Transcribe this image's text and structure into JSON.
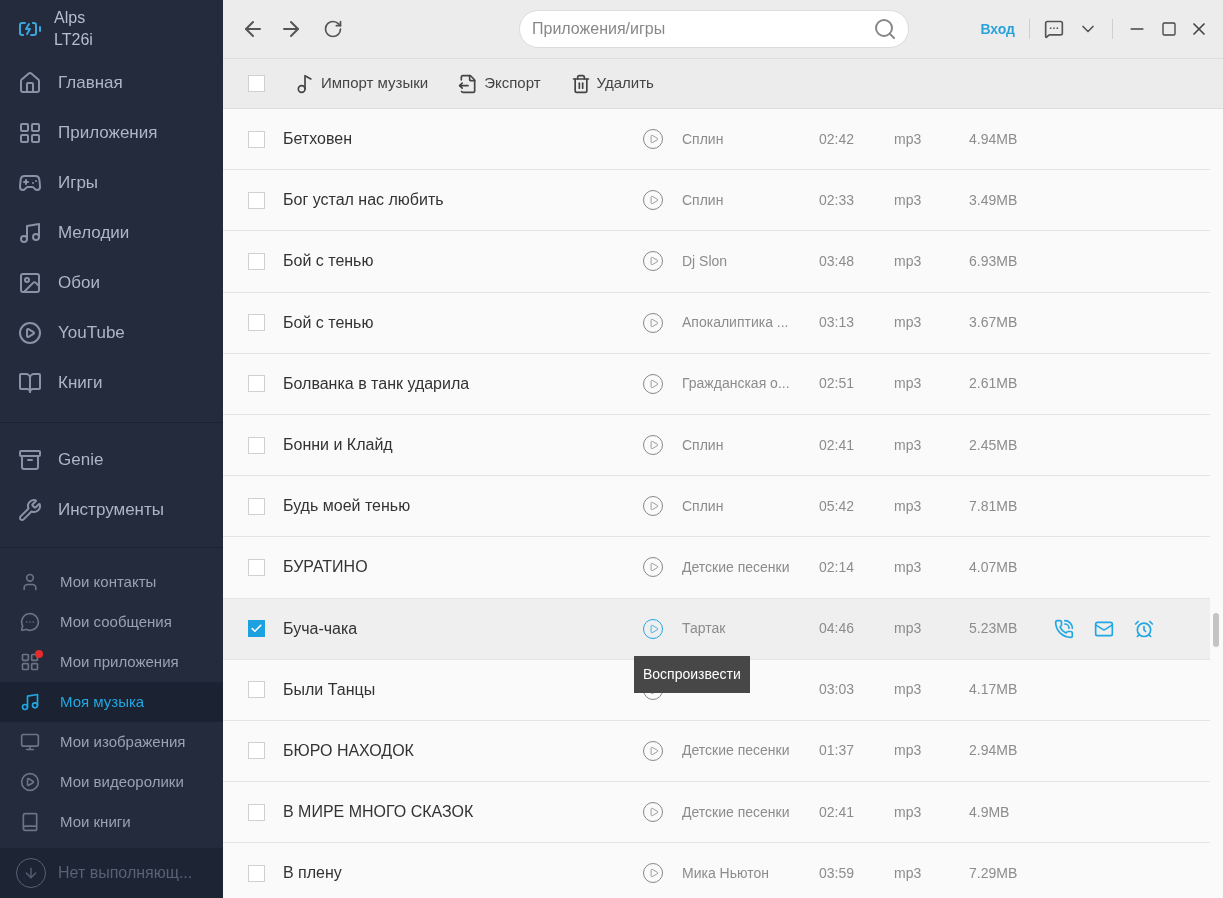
{
  "device": {
    "name": "Alps\nLT26i"
  },
  "nav": [
    {
      "label": "Главная"
    },
    {
      "label": "Приложения"
    },
    {
      "label": "Игры"
    },
    {
      "label": "Мелодии"
    },
    {
      "label": "Обои"
    },
    {
      "label": "YouTube"
    },
    {
      "label": "Книги"
    }
  ],
  "tools": [
    {
      "label": "Genie"
    },
    {
      "label": "Инструменты"
    }
  ],
  "my_items": [
    {
      "label": "Мои контакты",
      "selected": false,
      "notification": false
    },
    {
      "label": "Мои сообщения",
      "selected": false,
      "notification": false
    },
    {
      "label": "Мои приложения",
      "selected": false,
      "notification": true
    },
    {
      "label": "Моя музыка",
      "selected": true,
      "notification": false
    },
    {
      "label": "Мои изображения",
      "selected": false,
      "notification": false
    },
    {
      "label": "Мои видеоролики",
      "selected": false,
      "notification": false
    },
    {
      "label": "Мои книги",
      "selected": false,
      "notification": false
    }
  ],
  "tasks": {
    "label": "Нет выполняющ..."
  },
  "search": {
    "placeholder": "Приложения/игры"
  },
  "login": "Вход",
  "toolbar": {
    "select_all": false,
    "actions": [
      "Импорт музыки",
      "Экспорт",
      "Удалить"
    ]
  },
  "rows": [
    {
      "title": "Бетховен",
      "artist": "Сплин",
      "duration": "02:42",
      "format": "mp3",
      "size": "4.94MB",
      "checked": false
    },
    {
      "title": "Бог устал нас любить",
      "artist": "Сплин",
      "duration": "02:33",
      "format": "mp3",
      "size": "3.49MB",
      "checked": false
    },
    {
      "title": "Бой с тенью",
      "artist": "Dj Slon",
      "duration": "03:48",
      "format": "mp3",
      "size": "6.93MB",
      "checked": false
    },
    {
      "title": "Бой с тенью",
      "artist": "Апокалиптика ...",
      "duration": "03:13",
      "format": "mp3",
      "size": "3.67MB",
      "checked": false
    },
    {
      "title": "Болванка в танк ударила",
      "artist": "Гражданская о...",
      "duration": "02:51",
      "format": "mp3",
      "size": "2.61MB",
      "checked": false
    },
    {
      "title": "Бонни и Клайд",
      "artist": "Сплин",
      "duration": "02:41",
      "format": "mp3",
      "size": "2.45MB",
      "checked": false
    },
    {
      "title": "Будь моей тенью",
      "artist": "Сплин",
      "duration": "05:42",
      "format": "mp3",
      "size": "7.81MB",
      "checked": false
    },
    {
      "title": "БУРАТИНО",
      "artist": "Детские песенки",
      "duration": "02:14",
      "format": "mp3",
      "size": "4.07MB",
      "checked": false
    },
    {
      "title": "Буча-чака",
      "artist": "Тартак",
      "duration": "04:46",
      "format": "mp3",
      "size": "5.23MB",
      "checked": true,
      "tooltip": "Воспроизвести"
    },
    {
      "title": "Были Танцы",
      "duration": "03:03",
      "format": "mp3",
      "size": "4.17MB",
      "checked": false
    },
    {
      "title": "БЮРО НАХОДОК",
      "artist": "Детские песенки",
      "duration": "01:37",
      "format": "mp3",
      "size": "2.94MB",
      "checked": false
    },
    {
      "title": "В МИРЕ МНОГО СКАЗОК",
      "artist": "Детские песенки",
      "duration": "02:41",
      "format": "mp3",
      "size": "4.9MB",
      "checked": false
    },
    {
      "title": "В плену",
      "artist": "Мика Ньютон",
      "duration": "03:59",
      "format": "mp3",
      "size": "7.29MB",
      "checked": false
    }
  ]
}
